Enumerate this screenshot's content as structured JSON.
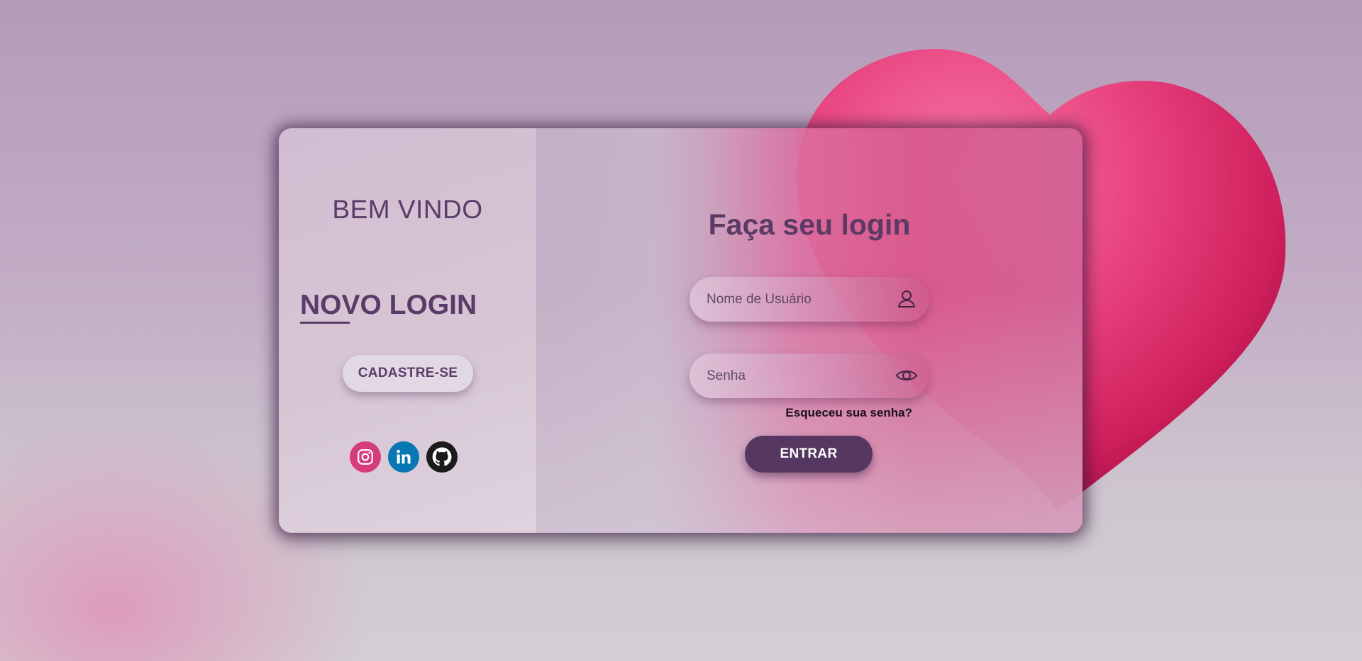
{
  "left_panel": {
    "welcome_text": "BEM VINDO",
    "new_login_text": "NOVO LOGIN",
    "signup_label": "CADASTRE-SE",
    "socials": [
      {
        "name": "instagram-icon",
        "color": "#d63c7c"
      },
      {
        "name": "linkedin-icon",
        "color": "#0a77b5"
      },
      {
        "name": "github-icon",
        "color": "#1b1b1b"
      }
    ]
  },
  "right_panel": {
    "title": "Faça seu login",
    "username": {
      "placeholder": "Nome de Usuário",
      "value": "",
      "icon": "user-icon"
    },
    "password": {
      "placeholder": "Senha",
      "value": "",
      "icon": "eye-icon"
    },
    "forgot_label": "Esqueceu sua senha?",
    "enter_label": "ENTRAR"
  },
  "colors": {
    "primary": "#5b3c69",
    "button_dark": "#553761",
    "heart": "#e23a7a"
  }
}
